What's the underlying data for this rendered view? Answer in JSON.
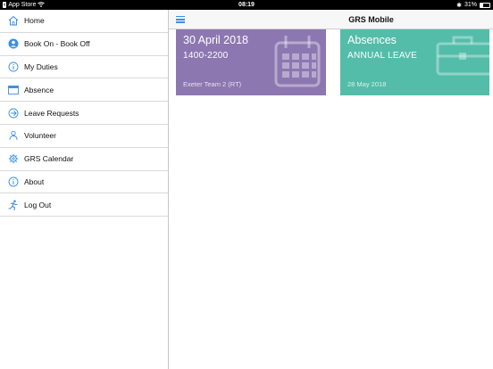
{
  "status_bar": {
    "back_app": "App Store",
    "time": "08:19",
    "battery": "31%",
    "battery_level": 0.31
  },
  "nav": {
    "title": "GRS Mobile"
  },
  "sidebar": {
    "items": [
      {
        "label": "Home",
        "icon": "home-icon"
      },
      {
        "label": "Book On - Book Off",
        "icon": "user-circle-icon"
      },
      {
        "label": "My Duties",
        "icon": "info-circle-icon"
      },
      {
        "label": "Absence",
        "icon": "window-icon"
      },
      {
        "label": "Leave Requests",
        "icon": "plane-circle-icon"
      },
      {
        "label": "Volunteer",
        "icon": "person-icon"
      },
      {
        "label": "GRS Calendar",
        "icon": "gear-icon"
      },
      {
        "label": "About",
        "icon": "info-icon"
      },
      {
        "label": "Log Out",
        "icon": "running-person-icon"
      }
    ]
  },
  "cards": {
    "duty": {
      "date": "30 April 2018",
      "time": "1400-2200",
      "team": "Exeter Team 2 (RT)",
      "color": "#8d77b1",
      "icon": "calendar-icon"
    },
    "absence": {
      "title": "Absences",
      "type": "ANNUAL LEAVE",
      "date": "28 May 2018",
      "color": "#53bda9",
      "icon": "briefcase-icon"
    }
  },
  "colors": {
    "accent": "#3d8fe0"
  }
}
